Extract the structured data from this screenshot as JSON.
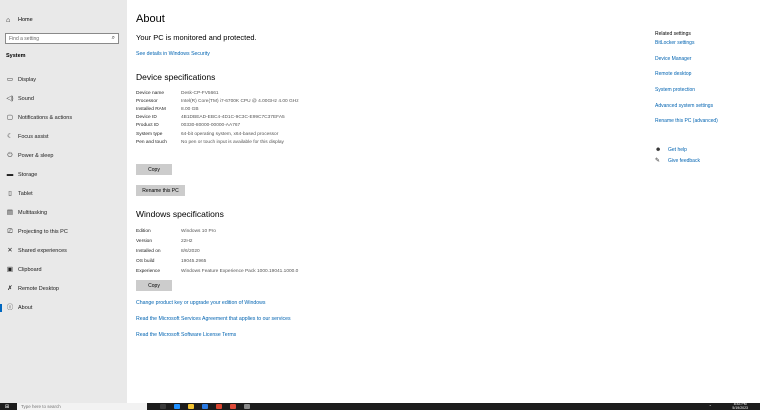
{
  "sidebar": {
    "home_label": "Home",
    "search_placeholder": "Find a setting",
    "section_label": "System",
    "items": [
      {
        "label": "Display",
        "icon": "display-icon"
      },
      {
        "label": "Sound",
        "icon": "sound-icon"
      },
      {
        "label": "Notifications & actions",
        "icon": "notifications-icon"
      },
      {
        "label": "Focus assist",
        "icon": "focus-assist-icon"
      },
      {
        "label": "Power & sleep",
        "icon": "power-icon"
      },
      {
        "label": "Storage",
        "icon": "storage-icon"
      },
      {
        "label": "Tablet",
        "icon": "tablet-icon"
      },
      {
        "label": "Multitasking",
        "icon": "multitasking-icon"
      },
      {
        "label": "Projecting to this PC",
        "icon": "projecting-icon"
      },
      {
        "label": "Shared experiences",
        "icon": "shared-experiences-icon"
      },
      {
        "label": "Clipboard",
        "icon": "clipboard-icon"
      },
      {
        "label": "Remote Desktop",
        "icon": "remote-desktop-icon"
      },
      {
        "label": "About",
        "icon": "about-icon"
      }
    ],
    "active_item": "About"
  },
  "main": {
    "title": "About",
    "protection_heading": "Your PC is monitored and protected.",
    "security_link": "See details in Windows Security",
    "device_specs": {
      "title": "Device specifications",
      "rows": [
        {
          "key": "Device name",
          "value": "Desk-CP-FV5661"
        },
        {
          "key": "Processor",
          "value": "Intel(R) Core(TM) i7-6700K CPU @ 4.00GHz   4.00 GHz"
        },
        {
          "key": "Installed RAM",
          "value": "8.00 GB"
        },
        {
          "key": "Device ID",
          "value": "4B1DBEAD-EBC4-4D1C-9C3C-E99C7C37EFA5"
        },
        {
          "key": "Product ID",
          "value": "00330-80000-00000-AA767"
        },
        {
          "key": "System type",
          "value": "64-bit operating system, x64-based processor"
        },
        {
          "key": "Pen and touch",
          "value": "No pen or touch input is available for this display"
        }
      ],
      "copy_label": "Copy",
      "rename_label": "Rename this PC"
    },
    "windows_specs": {
      "title": "Windows specifications",
      "rows": [
        {
          "key": "Edition",
          "value": "Windows 10 Pro"
        },
        {
          "key": "Version",
          "value": "22H2"
        },
        {
          "key": "Installed on",
          "value": "8/6/2020"
        },
        {
          "key": "OS build",
          "value": "19045.2965"
        },
        {
          "key": "Experience",
          "value": "Windows Feature Experience Pack 1000.19041.1000.0"
        }
      ],
      "copy_label": "Copy"
    },
    "links": [
      "Change product key or upgrade your edition of Windows",
      "Read the Microsoft Services Agreement that applies to our services",
      "Read the Microsoft Software License Terms"
    ]
  },
  "related": {
    "header": "Related settings",
    "links": [
      "BitLocker settings",
      "Device Manager",
      "Remote desktop",
      "System protection",
      "Advanced system settings",
      "Rename this PC (advanced)"
    ],
    "help_items": [
      {
        "label": "Get help",
        "icon": "help-icon"
      },
      {
        "label": "Give feedback",
        "icon": "feedback-icon"
      }
    ]
  },
  "taskbar": {
    "search_placeholder": "Type here to search",
    "time": "8:43 PM",
    "date": "5/19/2023"
  },
  "colors": {
    "accent": "#0063b1",
    "sidebar_bg": "#e9e9e9",
    "taskbar_bg": "#1c1c1c",
    "button_bg": "#cccccc"
  }
}
